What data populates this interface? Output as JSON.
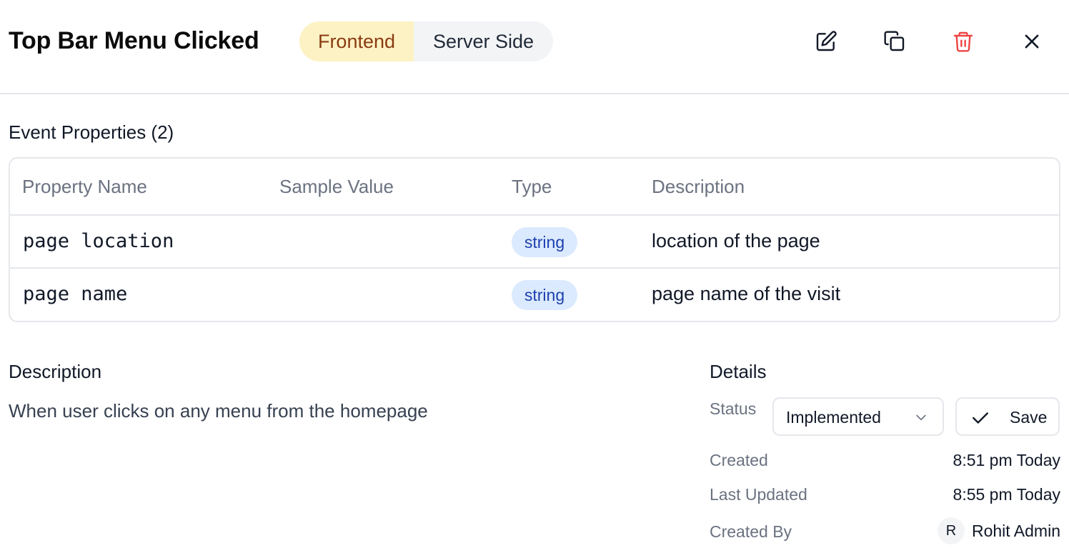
{
  "header": {
    "title": "Top Bar Menu Clicked",
    "segments": [
      {
        "label": "Frontend",
        "selected": true
      },
      {
        "label": "Server Side",
        "selected": false
      }
    ],
    "actions": {
      "edit_icon": "edit-icon",
      "copy_icon": "copy-icon",
      "delete_icon": "trash-icon",
      "close_icon": "close-icon"
    },
    "colors": {
      "delete": "#ef4444",
      "active_segment_bg": "#fdf2c4",
      "active_segment_text": "#8a3b12"
    }
  },
  "properties": {
    "title": "Event Properties (2)",
    "columns": [
      "Property Name",
      "Sample Value",
      "Type",
      "Description"
    ],
    "rows": [
      {
        "name": "page location",
        "sample": "",
        "type": "string",
        "description": "location of the page"
      },
      {
        "name": "page name",
        "sample": "",
        "type": "string",
        "description": "page name of the visit"
      }
    ]
  },
  "description": {
    "title": "Description",
    "text": "When user clicks on any menu from the homepage"
  },
  "details": {
    "title": "Details",
    "status_label": "Status",
    "status_value": "Implemented",
    "save_label": "Save",
    "created_label": "Created",
    "created_value": "8:51 pm Today",
    "updated_label": "Last Updated",
    "updated_value": "8:55 pm Today",
    "created_by_label": "Created By",
    "creator_initial": "R",
    "creator_name": "Rohit Admin"
  }
}
